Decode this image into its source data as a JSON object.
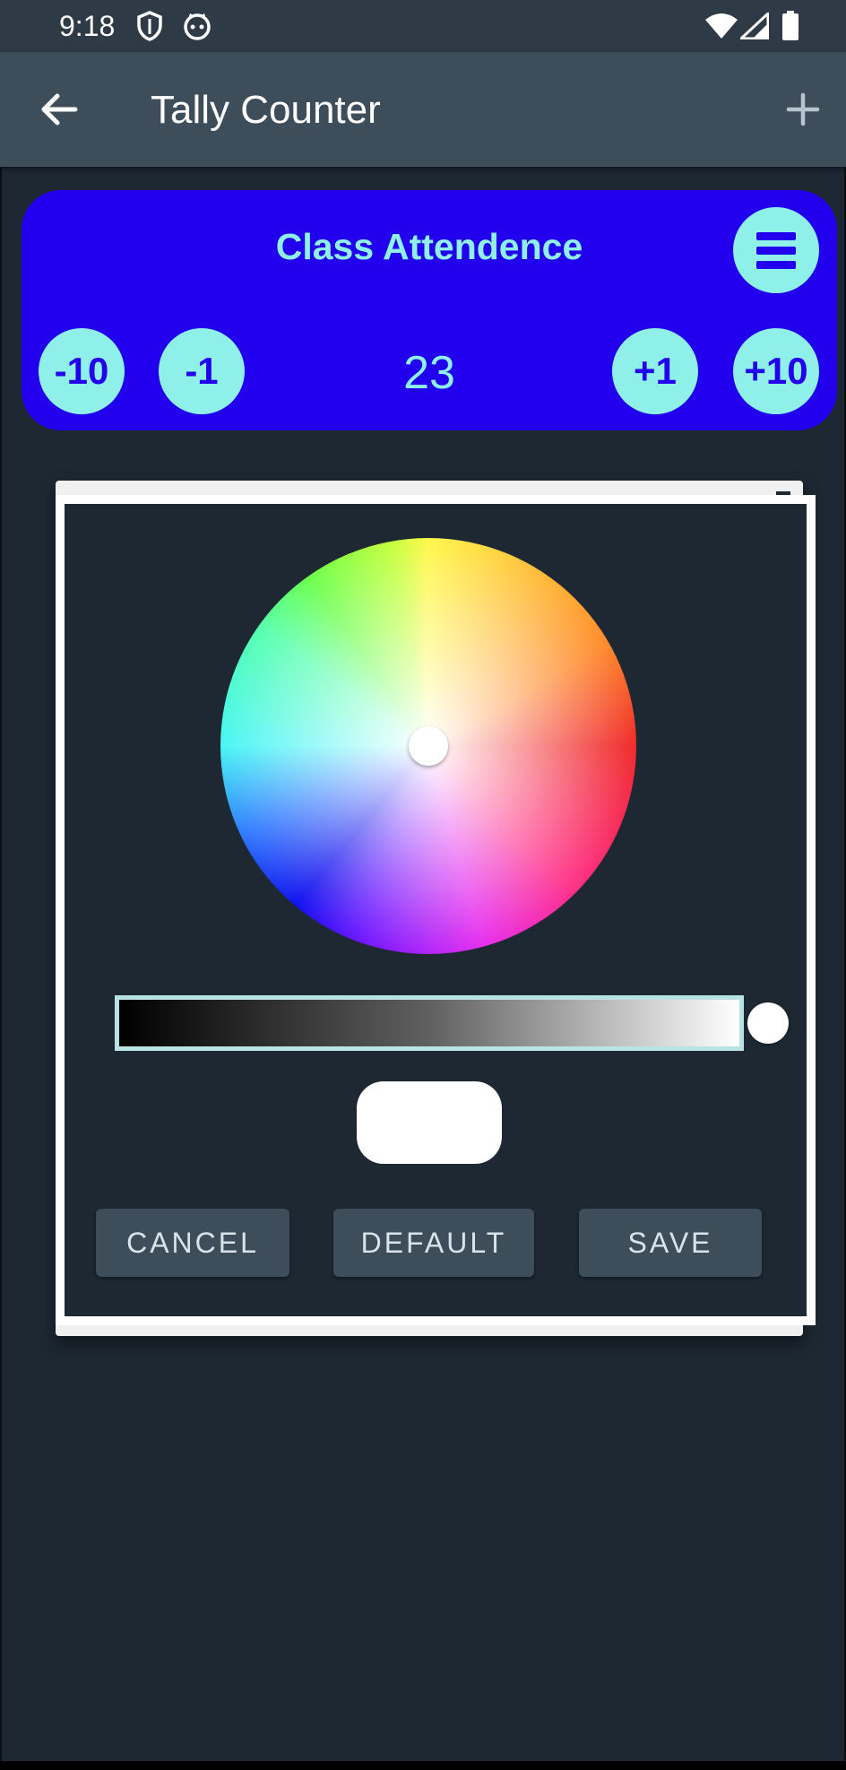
{
  "status_bar": {
    "time": "9:18",
    "icons": [
      "shield-icon",
      "cat-face-icon",
      "wifi-icon",
      "signal-icon",
      "battery-icon"
    ]
  },
  "app_bar": {
    "title": "Tally Counter",
    "back_icon": "arrow-left-icon",
    "add_icon": "plus-icon"
  },
  "counter": {
    "name": "Class Attendence",
    "value": "23",
    "buttons": {
      "minus_ten": "-10",
      "minus_one": "-1",
      "plus_one": "+1",
      "plus_ten": "+10"
    },
    "menu_icon": "menu-icon",
    "colors": {
      "card": "#2200ee",
      "accent": "#8ef0e8"
    }
  },
  "color_picker": {
    "selected_color": "#ffffff",
    "brightness_level": 1.0,
    "buttons": {
      "cancel": "CANCEL",
      "default": "DEFAULT",
      "save": "SAVE"
    }
  }
}
